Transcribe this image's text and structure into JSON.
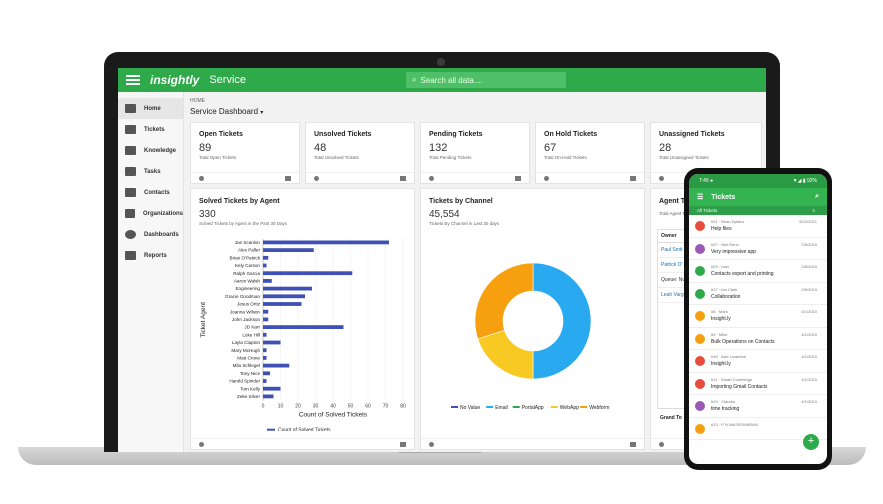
{
  "app": {
    "logo": "insightly",
    "product": "Service",
    "search_placeholder": "Search all data....",
    "brand_color": "#2eaa4a"
  },
  "sidebar": {
    "items": [
      {
        "label": "Home",
        "icon": "home-icon"
      },
      {
        "label": "Tickets",
        "icon": "tickets-icon"
      },
      {
        "label": "Knowledge",
        "icon": "book-icon"
      },
      {
        "label": "Tasks",
        "icon": "tasks-icon"
      },
      {
        "label": "Contacts",
        "icon": "contacts-icon"
      },
      {
        "label": "Organizations",
        "icon": "building-icon"
      },
      {
        "label": "Dashboards",
        "icon": "dashboard-icon"
      },
      {
        "label": "Reports",
        "icon": "reports-icon"
      }
    ]
  },
  "breadcrumb": "HOME",
  "dashboard_title": "Service Dashboard",
  "stats": [
    {
      "title": "Open Tickets",
      "value": "89",
      "sub": "Total Open Tickets"
    },
    {
      "title": "Unsolved Tickets",
      "value": "48",
      "sub": "Total Unsolved Tickets"
    },
    {
      "title": "Pending Tickets",
      "value": "132",
      "sub": "Total Pending Tickets"
    },
    {
      "title": "On Hold Tickets",
      "value": "67",
      "sub": "Total On-Hold Tickets"
    },
    {
      "title": "Unassigned Tickets",
      "value": "28",
      "sub": "Total Unassigned Tickets"
    }
  ],
  "bar_card": {
    "title": "Solved Tickets by Agent",
    "value": "330",
    "sub": "Solved Tickets by Agent in the Past 30 Days"
  },
  "donut_card": {
    "title": "Tickets by Channel",
    "value": "45,554",
    "sub": "Tickets By Channel in Last 30 days"
  },
  "agent_card": {
    "title": "Agent Ti",
    "sub": "Total Agent Tick",
    "owner_header": "Owner",
    "rows": [
      "Paul Smit",
      "Patrick O'",
      "Queue: No",
      "Leah Varg"
    ],
    "footer": "Grand To"
  },
  "chart_data": [
    {
      "type": "bar",
      "orientation": "horizontal",
      "categories": [
        "Joe Scanlon",
        "Alex Paller",
        "Brian O'Patrick",
        "Kely Carson",
        "Ralph Garcia",
        "Aaron Walsh",
        "Engineering",
        "Gracie Goodman",
        "Jesus Ortiz",
        "Joanna Wilson",
        "John Jackson",
        "JD Karr",
        "Luke Hill",
        "Layla Clapton",
        "Mary McHugh",
        "Matt Crone",
        "Mila Schlegel",
        "Tony Nice",
        "Harold Spinder",
        "Tom Kelly",
        "Zeke Silver"
      ],
      "values": [
        72,
        29,
        3,
        2,
        51,
        5,
        28,
        24,
        22,
        3,
        3,
        46,
        2,
        10,
        2,
        2,
        15,
        4,
        2,
        10,
        6
      ],
      "xlabel": "Count of Solved Tickets",
      "ylabel": "Ticket Agent",
      "xlim": [
        0,
        80
      ],
      "xticks": [
        0,
        10,
        20,
        30,
        40,
        50,
        60,
        70,
        80
      ],
      "legend": [
        "Count of Solved Tickets"
      ],
      "color": "#3f51b5"
    },
    {
      "type": "pie",
      "donut": true,
      "categories": [
        "No Value",
        "Email",
        "PortalApp",
        "WebApp",
        "Webform"
      ],
      "values": [
        0,
        50,
        0,
        20,
        30
      ],
      "colors": [
        "#3f51b5",
        "#29a9f0",
        "#2eaa4a",
        "#f9c923",
        "#f6a010"
      ]
    }
  ],
  "phone": {
    "time": "7:45 ●",
    "battery": "▼◢ ▮ 92%",
    "title": "Tickets",
    "filter": "All Tickets",
    "tickets": [
      {
        "meta": "#21 · Brian Zylstra",
        "text": "Help files",
        "date": "9/22/2021",
        "color": "#e74c3c"
      },
      {
        "meta": "#27 · Neil Renn",
        "text": "Very impressive app",
        "date": "2/6/2019",
        "color": "#9b59b6"
      },
      {
        "meta": "#29 · Ivan",
        "text": "Contacts export and printing",
        "date": "2/6/2019",
        "color": "#2eaa4a"
      },
      {
        "meta": "#27 · Ian Clark",
        "text": "Collaboration",
        "date": "2/6/2019",
        "color": "#2eaa4a"
      },
      {
        "meta": "#8 · Mark",
        "text": "Insight.ly",
        "date": "4/1/2010",
        "color": "#f6a010"
      },
      {
        "meta": "#9 · Mike",
        "text": "Bulk Operations on Contacts",
        "date": "4/1/2010",
        "color": "#f6a010"
      },
      {
        "meta": "#16 · Alex Lowbrink",
        "text": "Insight.ly",
        "date": "4/1/2010",
        "color": "#e74c3c"
      },
      {
        "meta": "#11 · Stuart Cummings",
        "text": "Importing Gmail Contacts",
        "date": "4/1/2010",
        "color": "#e74c3c"
      },
      {
        "meta": "#20 · Claudia",
        "text": "time tracking",
        "date": "4/1/2010",
        "color": "#9b59b6"
      },
      {
        "meta": "#13 · P N NAGESWARAN",
        "text": "",
        "date": "",
        "color": "#f6a010"
      }
    ],
    "fab": "+"
  }
}
